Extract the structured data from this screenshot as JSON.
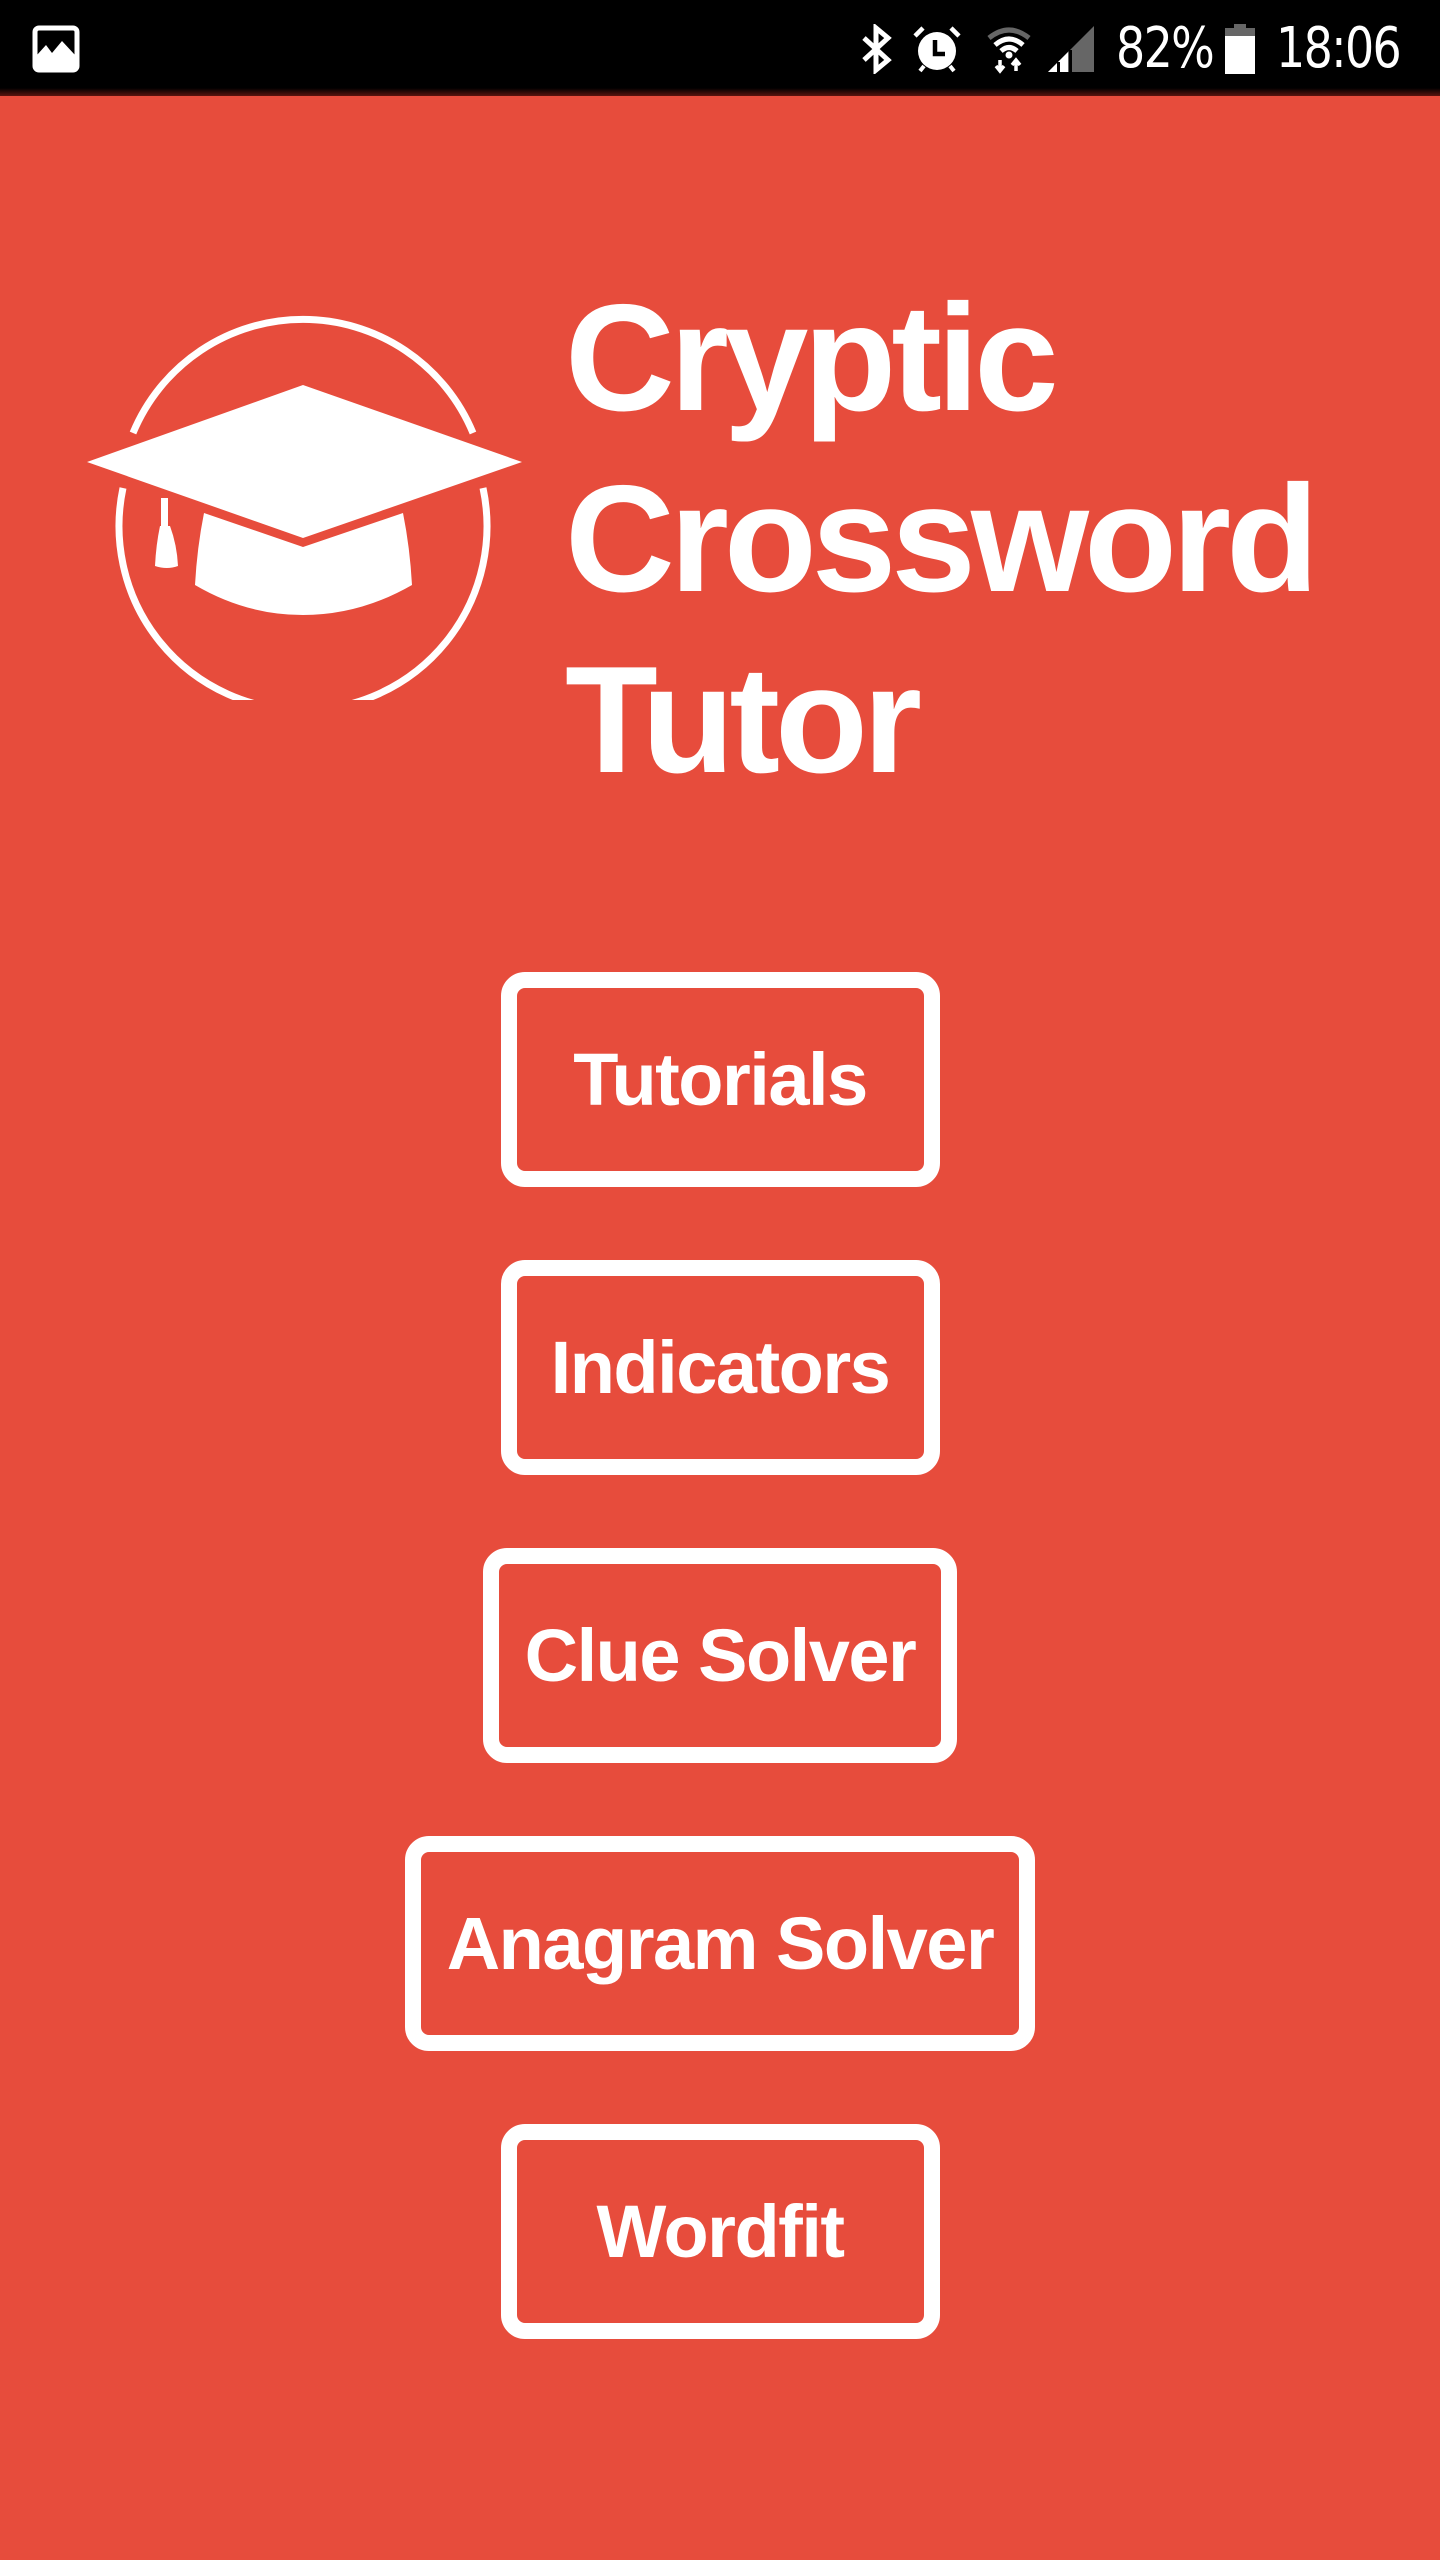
{
  "status_bar": {
    "left_icons": [
      "image-notification-icon"
    ],
    "right_icons": [
      "bluetooth-icon",
      "alarm-icon",
      "wifi-icon",
      "cellular-signal-icon"
    ],
    "battery_percent": "82%",
    "battery_level": 0.82,
    "time": "18:06"
  },
  "header": {
    "logo_icon": "graduation-cap-icon",
    "title_lines": [
      "Cryptic",
      "Crossword",
      "Tutor"
    ]
  },
  "menu": {
    "buttons": [
      {
        "label": "Tutorials"
      },
      {
        "label": "Indicators"
      },
      {
        "label": "Clue Solver"
      },
      {
        "label": "Anagram Solver"
      },
      {
        "label": "Wordfit"
      }
    ]
  },
  "theme": {
    "background": "#E74C3C",
    "foreground": "#FFFFFF",
    "status_bar_background": "#000000"
  }
}
